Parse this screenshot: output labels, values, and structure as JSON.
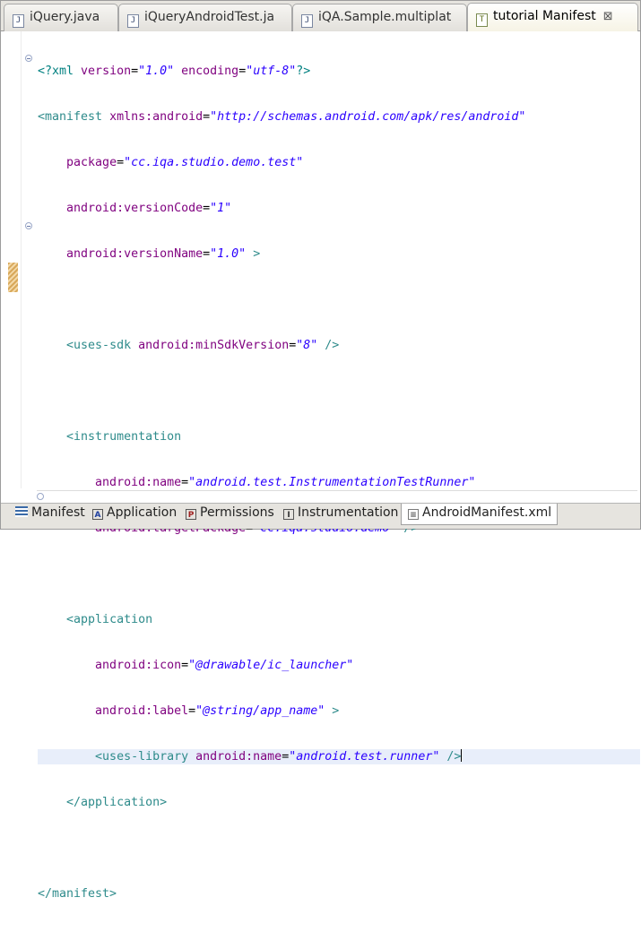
{
  "tabs": [
    {
      "label": "iQuery.java",
      "icon": "java-file-icon"
    },
    {
      "label": "iQueryAndroidTest.ja",
      "icon": "java-file-icon"
    },
    {
      "label": "iQA.Sample.multiplat",
      "icon": "java-file-icon"
    },
    {
      "label": "tutorial Manifest",
      "icon": "manifest-file-icon",
      "active": true,
      "close": "⊠"
    }
  ],
  "code": {
    "l1": {
      "open": "<?xml ",
      "a1": "version",
      "eq1": "=",
      "v1": "\"1.0\"",
      "a2": " encoding",
      "eq2": "=",
      "v2": "\"utf-8\"",
      "close": "?>"
    },
    "l2": {
      "open": "<manifest ",
      "a1": "xmlns:android",
      "eq": "=",
      "v1": "\"http://schemas.android.com/apk/res/android\""
    },
    "l3": {
      "a": "package",
      "eq": "=",
      "v": "\"cc.iqa.studio.demo.test\""
    },
    "l4": {
      "a": "android:versionCode",
      "eq": "=",
      "v": "\"1\""
    },
    "l5": {
      "a": "android:versionName",
      "eq": "=",
      "v": "\"1.0\"",
      "close": " >"
    },
    "l7": {
      "open": "<uses-sdk ",
      "a": "android:minSdkVersion",
      "eq": "=",
      "v": "\"8\"",
      "close": " />"
    },
    "l9": {
      "open": "<instrumentation"
    },
    "l10": {
      "a": "android:name",
      "eq": "=",
      "v": "\"android.test.InstrumentationTestRunner\""
    },
    "l11": {
      "a": "android:targetPackage",
      "eq": "=",
      "v": "\"cc.iqa.studio.demo\"",
      "close": " />"
    },
    "l13": {
      "open": "<application"
    },
    "l14": {
      "a": "android:icon",
      "eq": "=",
      "v": "\"@drawable/ic_launcher\""
    },
    "l15": {
      "a": "android:label",
      "eq": "=",
      "v": "\"@string/app_name\"",
      "close": " >"
    },
    "l16": {
      "open": "<uses-library ",
      "a": "android:name",
      "eq": "=",
      "v": "\"android.test.runner\"",
      "close": " />"
    },
    "l17": {
      "close": "</application>"
    },
    "l19": {
      "close": "</manifest>"
    }
  },
  "bottom_tabs": [
    {
      "label": "Manifest",
      "icon": "manifest-icon"
    },
    {
      "label": "Application",
      "icon": "application-icon",
      "glyph": "A"
    },
    {
      "label": "Permissions",
      "icon": "permissions-icon",
      "glyph": "P"
    },
    {
      "label": "Instrumentation",
      "icon": "instrumentation-icon",
      "glyph": "I"
    },
    {
      "label": "AndroidManifest.xml",
      "icon": "xml-file-icon",
      "active": true
    }
  ]
}
